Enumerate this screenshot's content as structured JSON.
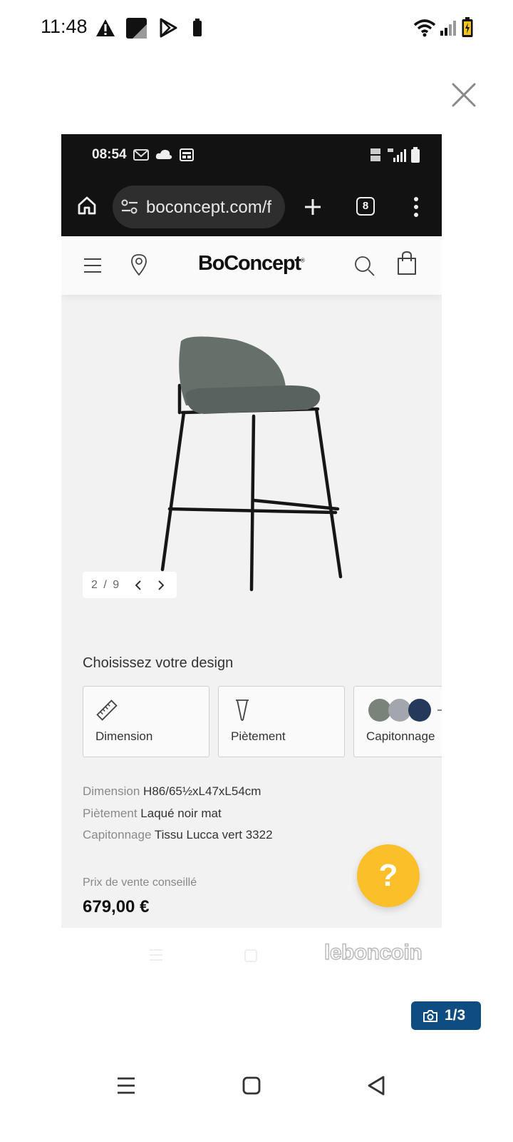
{
  "status_bar": {
    "time": "11:48",
    "icons": [
      "warning-icon",
      "image-icon",
      "play-store-icon",
      "battery-small-icon",
      "wifi-icon",
      "signal-icon",
      "battery-charging-icon"
    ]
  },
  "viewer": {
    "close_icon": "close-icon",
    "counter": "1/3",
    "watermark": "leboncoin"
  },
  "inner_phone": {
    "status_time": "08:54",
    "url": "boconcept.com/f",
    "tab_count": "8"
  },
  "site": {
    "logo": "BoConcept",
    "logo_mark": "®",
    "gallery_counter": "2 / 9",
    "design_title": "Choisissez votre design",
    "options": [
      {
        "label": "Dimension",
        "icon": "ruler-icon"
      },
      {
        "label": "Piètement",
        "icon": "chair-leg-icon"
      },
      {
        "label": "Capitonnage",
        "icon": "fabric-swatches-icon"
      }
    ],
    "specs": [
      {
        "key": "Dimension",
        "value": "H86/65½xL47xL54cm"
      },
      {
        "key": "Piètement",
        "value": "Laqué noir mat"
      },
      {
        "key": "Capitonnage",
        "value": "Tissu Lucca vert 3322"
      }
    ],
    "price_label": "Prix de vente conseillé",
    "price": "679,00 €",
    "help_label": "?"
  },
  "colors": {
    "help_button": "#fbbf2a",
    "counter_badge": "#0f4c81",
    "browser_bar": "#121212"
  }
}
